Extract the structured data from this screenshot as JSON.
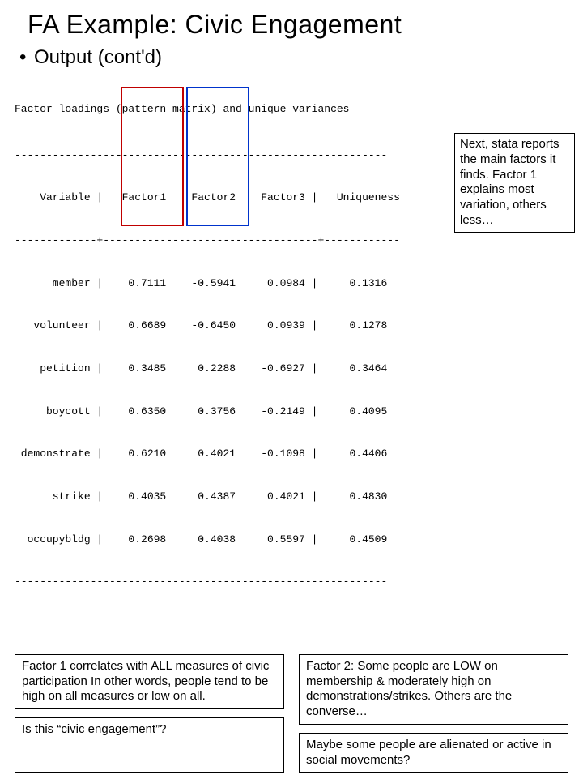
{
  "title": "FA Example:  Civic Engagement",
  "bullet": "Output (cont'd)",
  "output_heading": "Factor loadings (pattern matrix) and unique variances",
  "table": {
    "hr": "-----------------------------------------------------------",
    "head": "    Variable |   Factor1    Factor2    Factor3 |   Uniqueness",
    "sep": "-------------+----------------------------------+------------",
    "rows": [
      "      member |    0.7111    -0.5941     0.0984 |     0.1316",
      "   volunteer |    0.6689    -0.6450     0.0939 |     0.1278",
      "    petition |    0.3485     0.2288    -0.6927 |     0.3464",
      "     boycott |    0.6350     0.3756    -0.2149 |     0.4095",
      " demonstrate |    0.6210     0.4021    -0.1098 |     0.4406",
      "      strike |    0.4035     0.4387     0.4021 |     0.4830",
      "  occupybldg |    0.2698     0.4038     0.5597 |     0.4509"
    ]
  },
  "side_note": "Next, stata reports the main factors it finds.\nFactor 1 explains most variation, others less…",
  "left_box_1": "Factor 1 correlates with ALL measures of civic participation\nIn other words, people tend to be high on all measures or low on all.",
  "left_box_2": "Is this “civic engagement”?",
  "right_box_1": "Factor 2:  Some people are LOW on membership & moderately high on demonstrations/strikes.\nOthers are the converse…",
  "right_box_2": "Maybe some people are alienated or active in social movements?",
  "chart_data": {
    "type": "table",
    "title": "Factor loadings (pattern matrix) and unique variances",
    "columns": [
      "Variable",
      "Factor1",
      "Factor2",
      "Factor3",
      "Uniqueness"
    ],
    "rows": [
      {
        "Variable": "member",
        "Factor1": 0.7111,
        "Factor2": -0.5941,
        "Factor3": 0.0984,
        "Uniqueness": 0.1316
      },
      {
        "Variable": "volunteer",
        "Factor1": 0.6689,
        "Factor2": -0.645,
        "Factor3": 0.0939,
        "Uniqueness": 0.1278
      },
      {
        "Variable": "petition",
        "Factor1": 0.3485,
        "Factor2": 0.2288,
        "Factor3": -0.6927,
        "Uniqueness": 0.3464
      },
      {
        "Variable": "boycott",
        "Factor1": 0.635,
        "Factor2": 0.3756,
        "Factor3": -0.2149,
        "Uniqueness": 0.4095
      },
      {
        "Variable": "demonstrate",
        "Factor1": 0.621,
        "Factor2": 0.4021,
        "Factor3": -0.1098,
        "Uniqueness": 0.4406
      },
      {
        "Variable": "strike",
        "Factor1": 0.4035,
        "Factor2": 0.4387,
        "Factor3": 0.4021,
        "Uniqueness": 0.483
      },
      {
        "Variable": "occupybldg",
        "Factor1": 0.2698,
        "Factor2": 0.4038,
        "Factor3": 0.5597,
        "Uniqueness": 0.4509
      }
    ]
  }
}
